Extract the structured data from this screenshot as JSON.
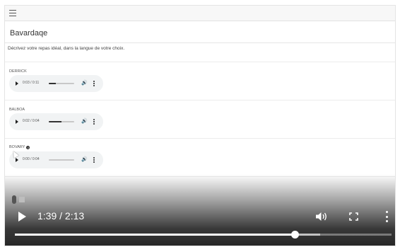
{
  "header": {
    "menu_icon": "hamburger-menu-icon"
  },
  "page": {
    "title": "Bavardaqe",
    "prompt": "Décrivez votre repas idéal, dans la langue de votre choix."
  },
  "entries": [
    {
      "name": "DERRICK",
      "time": "0:03 / 0:11",
      "progress": 0.27,
      "has_info": false
    },
    {
      "name": "BALBOA",
      "time": "0:02 / 0:04",
      "progress": 0.5,
      "has_info": false
    },
    {
      "name": "BOVARY",
      "time": "0:00 / 0:04",
      "progress": 0.0,
      "has_info": true
    }
  ],
  "recorder": {
    "mic_icon": "microphone-icon",
    "stop_icon": "stop-icon"
  },
  "video_controls": {
    "time": "1:39 / 2:13",
    "progress": 0.744,
    "buffered": 0.81,
    "icons": [
      "play-icon",
      "volume-icon",
      "fullscreen-icon",
      "more-vert-icon"
    ]
  },
  "colors": {
    "overlay": "#000000",
    "player_bg": "#f1f3f4",
    "track_fill": "#333333"
  }
}
